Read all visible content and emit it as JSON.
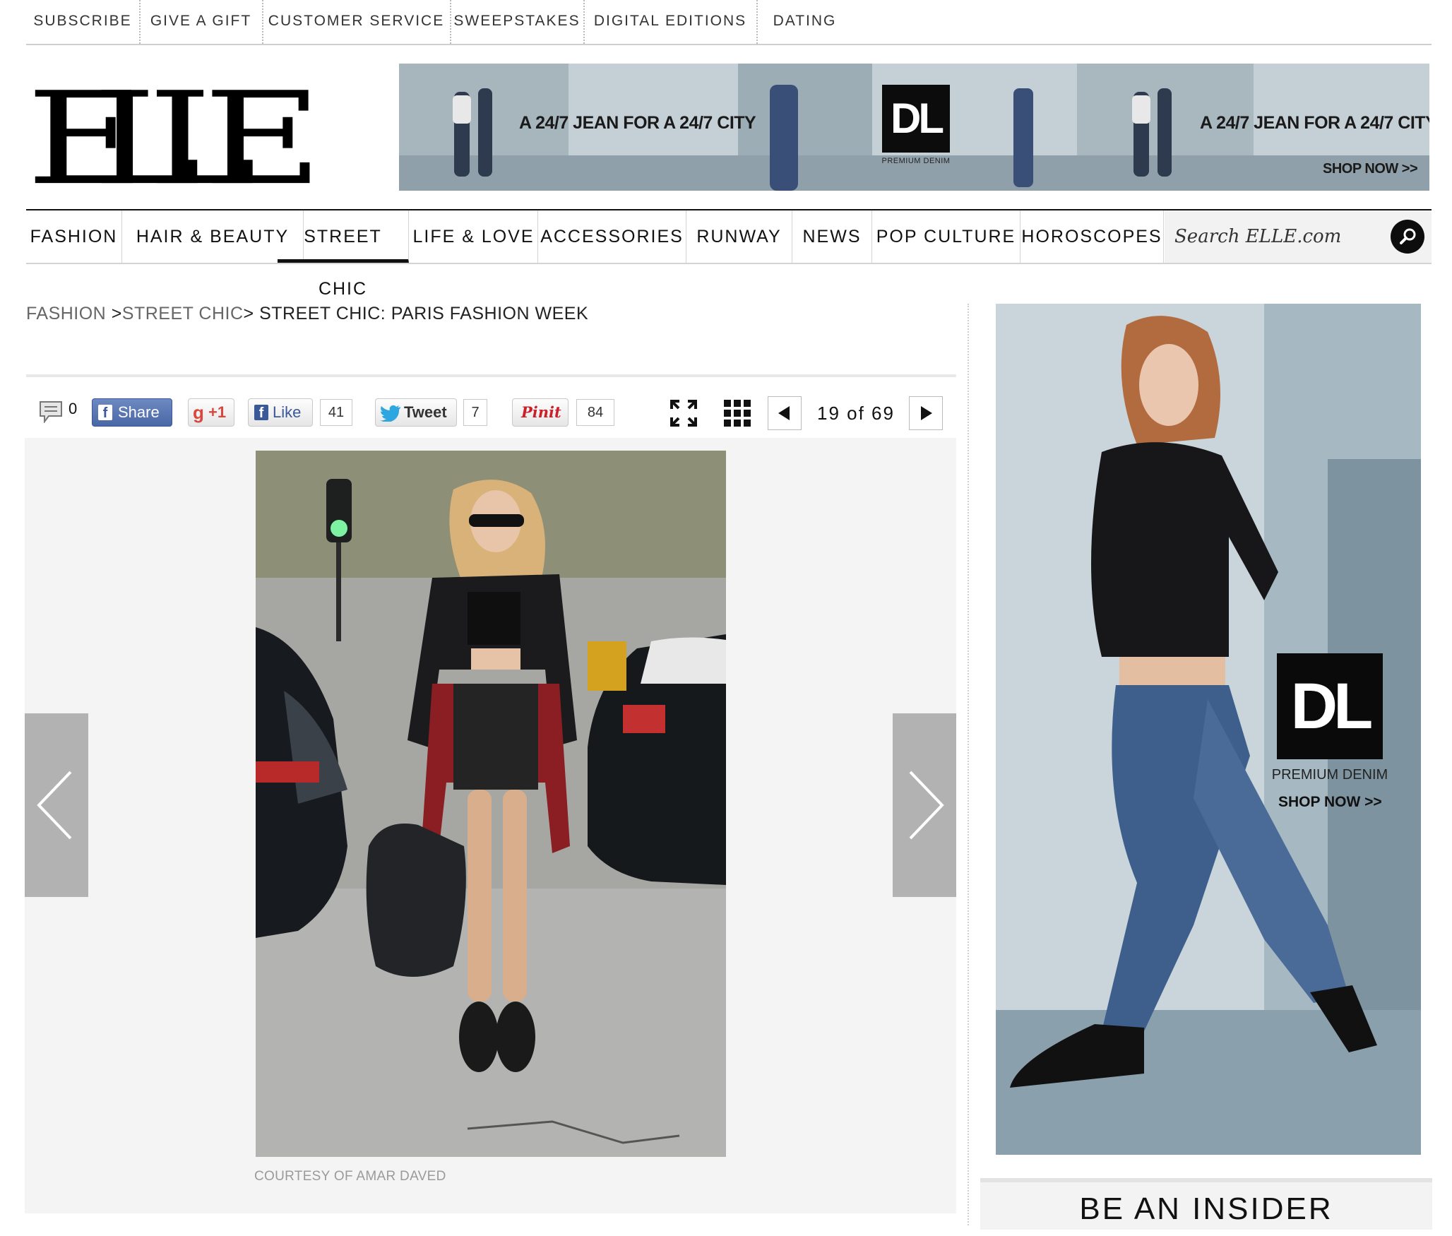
{
  "utility_nav": [
    "SUBSCRIBE",
    "GIVE A GIFT",
    "CUSTOMER SERVICE",
    "SWEEPSTAKES",
    "DIGITAL EDITIONS",
    "DATING"
  ],
  "logo": {
    "text": "ELLE"
  },
  "banner_ad": {
    "tagline_left": "A 24/7 JEAN FOR A 24/7 CITY",
    "tagline_right": "A 24/7 JEAN FOR A 24/7 CITY",
    "brand": "DL",
    "brand_sub": "PREMIUM DENIM",
    "cta": "SHOP NOW >>"
  },
  "main_nav": {
    "items": [
      "FASHION",
      "HAIR & BEAUTY",
      "STREET CHIC",
      "LIFE & LOVE",
      "ACCESSORIES",
      "RUNWAY",
      "NEWS",
      "POP CULTURE",
      "HOROSCOPES"
    ],
    "active": "STREET CHIC",
    "search_placeholder": "Search ELLE.com"
  },
  "breadcrumb": {
    "level1": "FASHION",
    "sep1": " >",
    "level2": "STREET CHIC",
    "sep2": "> ",
    "current": "STREET CHIC: PARIS FASHION WEEK"
  },
  "toolbar": {
    "comment_count": "0",
    "fb_share_label": "Share",
    "gplus_label": "+1",
    "like_label": "Like",
    "like_count": "41",
    "tweet_label": "Tweet",
    "tweet_count": "7",
    "pin_label": "Pinit",
    "pin_count": "84",
    "pager": "19 of 69"
  },
  "slideshow": {
    "caption": "COURTESY OF AMAR DAVED"
  },
  "side_ad": {
    "brand": "DL",
    "brand_sub": "PREMIUM DENIM",
    "cta": "SHOP NOW >>"
  },
  "insider": {
    "heading": "BE AN INSIDER"
  },
  "colors": {
    "accent": "#111111",
    "toolbar_border": "#c9c9c9",
    "stage_bg": "#f4f4f4",
    "arrow_panel": "#b2b2b2"
  }
}
